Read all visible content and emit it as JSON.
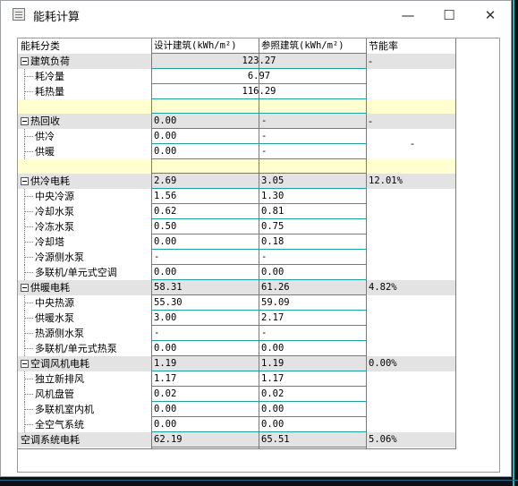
{
  "window": {
    "title": "能耗计算",
    "min_glyph": "—",
    "max_glyph": "☐",
    "close_glyph": "✕"
  },
  "table": {
    "headers": [
      "能耗分类",
      "设计建筑(kWh/m²)",
      "参照建筑(kWh/m²)",
      "节能率"
    ],
    "building_load": {
      "label": "建筑负荷",
      "value": "123.27",
      "ratio": "-",
      "children": [
        {
          "label": "耗冷量",
          "value": "6.97"
        },
        {
          "label": "耗热量",
          "value": "116.29"
        }
      ]
    },
    "heat_recovery": {
      "label": "热回收",
      "design": "0.00",
      "ref": "-",
      "ratio": "-",
      "children": [
        {
          "label": "供冷",
          "design": "0.00",
          "ref": "-"
        },
        {
          "label": "供暖",
          "design": "0.00",
          "ref": "-"
        }
      ],
      "child_ratio": "-"
    },
    "cooling": {
      "label": "供冷电耗",
      "design": "2.69",
      "ref": "3.05",
      "ratio": "12.01%",
      "children": [
        {
          "label": "中央冷源",
          "design": "1.56",
          "ref": "1.30"
        },
        {
          "label": "冷却水泵",
          "design": "0.62",
          "ref": "0.81"
        },
        {
          "label": "冷冻水泵",
          "design": "0.50",
          "ref": "0.75"
        },
        {
          "label": "冷却塔",
          "design": "0.00",
          "ref": "0.18"
        },
        {
          "label": "冷源侧水泵",
          "design": "-",
          "ref": "-"
        },
        {
          "label": "多联机/单元式空调",
          "design": "0.00",
          "ref": "0.00"
        }
      ]
    },
    "heating": {
      "label": "供暖电耗",
      "design": "58.31",
      "ref": "61.26",
      "ratio": "4.82%",
      "children": [
        {
          "label": "中央热源",
          "design": "55.30",
          "ref": "59.09"
        },
        {
          "label": "供暖水泵",
          "design": "3.00",
          "ref": "2.17"
        },
        {
          "label": "热源侧水泵",
          "design": "-",
          "ref": "-"
        },
        {
          "label": "多联机/单元式热泵",
          "design": "0.00",
          "ref": "0.00"
        }
      ]
    },
    "fan": {
      "label": "空调风机电耗",
      "design": "1.19",
      "ref": "1.19",
      "ratio": "0.00%",
      "children": [
        {
          "label": "独立新排风",
          "design": "1.17",
          "ref": "1.17"
        },
        {
          "label": "风机盘管",
          "design": "0.02",
          "ref": "0.02"
        },
        {
          "label": "多联机室内机",
          "design": "0.00",
          "ref": "0.00"
        },
        {
          "label": "全空气系统",
          "design": "0.00",
          "ref": "0.00"
        }
      ]
    },
    "total": {
      "label": "空调系统电耗",
      "design": "62.19",
      "ref": "65.51",
      "ratio": "5.06%"
    }
  },
  "colors": {
    "grid": "#20a0a0",
    "group_bg": "#e3e3e3",
    "separator_bg": "#ffffd0"
  }
}
